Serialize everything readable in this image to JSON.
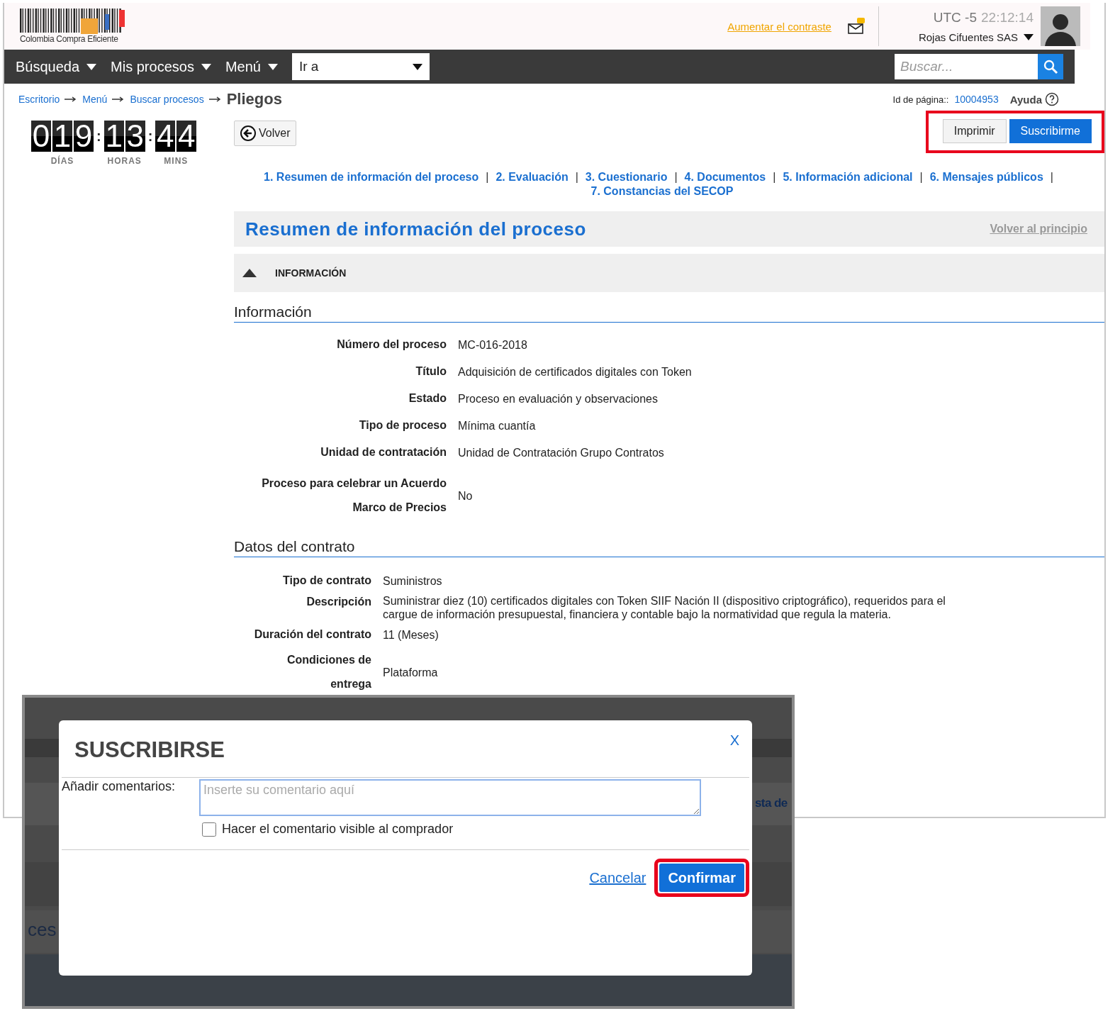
{
  "header": {
    "logo_text": "Colombia Compra Eficiente",
    "contrast_link": "Aumentar el contraste",
    "timezone": "UTC -5",
    "time": "22:12:14",
    "user": "Rojas Cifuentes SAS"
  },
  "nav": {
    "menus": [
      "Búsqueda",
      "Mis procesos",
      "Menú"
    ],
    "goto": {
      "value": "Ir a"
    },
    "search": {
      "placeholder": "Buscar..."
    }
  },
  "breadcrumb": {
    "links": [
      "Escritorio",
      "Menú",
      "Buscar procesos"
    ],
    "current": "Pliegos"
  },
  "page_id": {
    "label": "Id de página::",
    "value": "10004953"
  },
  "help": "Ayuda",
  "countdown": [
    {
      "digits": [
        "0",
        "1",
        "9"
      ],
      "label": "DÍAS"
    },
    {
      "digits": [
        "1",
        "3"
      ],
      "label": "HORAS"
    },
    {
      "digits": [
        "4",
        "4"
      ],
      "label": "MINS"
    }
  ],
  "countdown_separator": ":",
  "link_separator": "|",
  "back_button": "Volver",
  "actions": [
    {
      "label": "Imprimir",
      "kind": "secondary"
    },
    {
      "label": "Suscribirme",
      "kind": "primary"
    }
  ],
  "section_links": [
    "1. Resumen de información del proceso",
    "2. Evaluación",
    "3. Cuestionario",
    "4. Documentos",
    "5. Información adicional",
    "6. Mensajes públicos",
    "7. Constancias del SECOP"
  ],
  "section": {
    "title": "Resumen de información del proceso",
    "top_link": "Volver al principio"
  },
  "panel": {
    "title": "INFORMACIÓN",
    "expanded": true
  },
  "groups": [
    {
      "title": "Información",
      "rows": [
        {
          "label": "Número del proceso",
          "value": "MC-016-2018"
        },
        {
          "label": "Título",
          "value": "Adquisición de certificados digitales con Token"
        },
        {
          "label": "Estado",
          "value": "Proceso en evaluación y observaciones"
        },
        {
          "label": "Tipo de proceso",
          "value": "Mínima cuantía"
        },
        {
          "label": "Unidad de contratación",
          "value": "Unidad de Contratación Grupo Contratos"
        },
        {
          "label": "Proceso para celebrar un Acuerdo\nMarco de Precios",
          "value": "No"
        }
      ]
    },
    {
      "title": "Datos del contrato",
      "rows": [
        {
          "label": "Tipo de contrato",
          "value": "Suministros"
        },
        {
          "label": "Descripción",
          "value": "Suministrar diez (10) certificados digitales con Token SIIF Nación II (dispositivo criptográfico), requeridos para el cargue de información presupuestal, financiera y contable bajo la normatividad que regula la materia."
        },
        {
          "label": "Duración del contrato",
          "value": "11 (Meses)"
        },
        {
          "label": "Condiciones de\nentrega",
          "value": "Plataforma"
        }
      ]
    }
  ],
  "dialog": {
    "background_fragments": [
      "sta de",
      "ces"
    ],
    "title": "SUSCRIBIRSE",
    "close": "X",
    "comment_label": "Añadir comentarios:",
    "comment": {
      "placeholder": "Inserte su comentario aquí"
    },
    "visible_checkbox": {
      "label": "Hacer el comentario visible al comprador",
      "checked": false
    },
    "cancel": "Cancelar",
    "confirm": "Confirmar"
  }
}
